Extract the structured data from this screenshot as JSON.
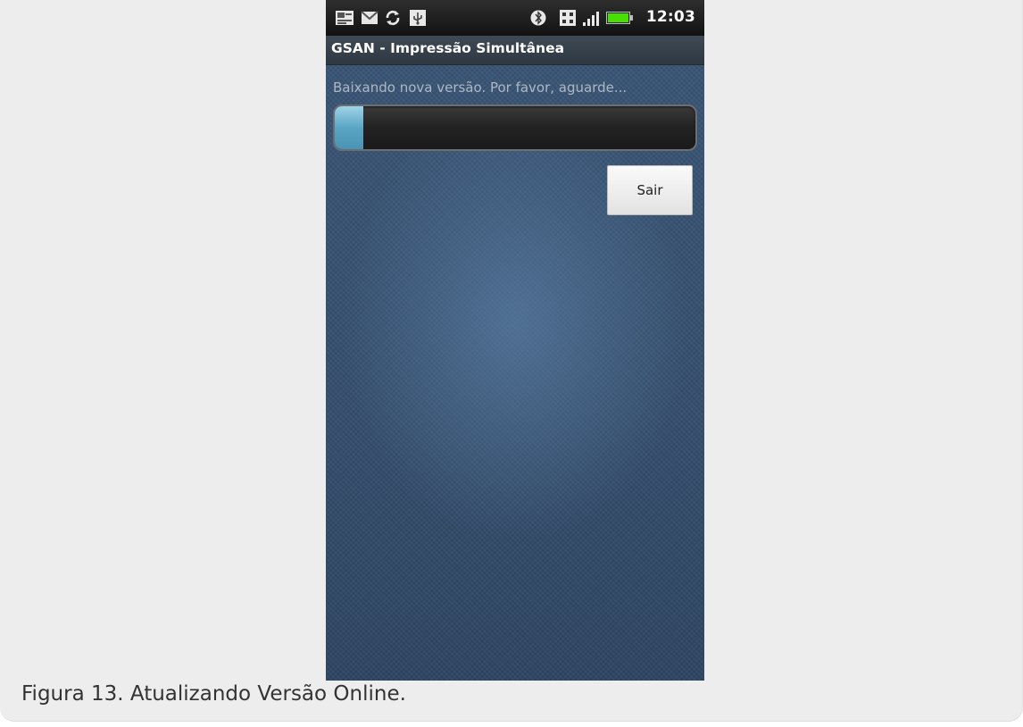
{
  "status_bar": {
    "left_icons": [
      "photo-notification-icon",
      "mail-icon",
      "sync-icon",
      "usb-icon"
    ],
    "right_icons": [
      "bluetooth-icon",
      "sd-card-icon",
      "signal-icon",
      "battery-icon"
    ],
    "time": "12:03",
    "battery_color": "#48e000"
  },
  "app": {
    "title": "GSAN - Impressão Simultânea"
  },
  "download": {
    "message": "Baixando nova versão. Por favor, aguarde...",
    "progress_fraction": 0.08,
    "progress_color": "#5aa5c5"
  },
  "actions": {
    "exit_label": "Sair"
  },
  "caption": "Figura 13. Atualizando Versão Online."
}
